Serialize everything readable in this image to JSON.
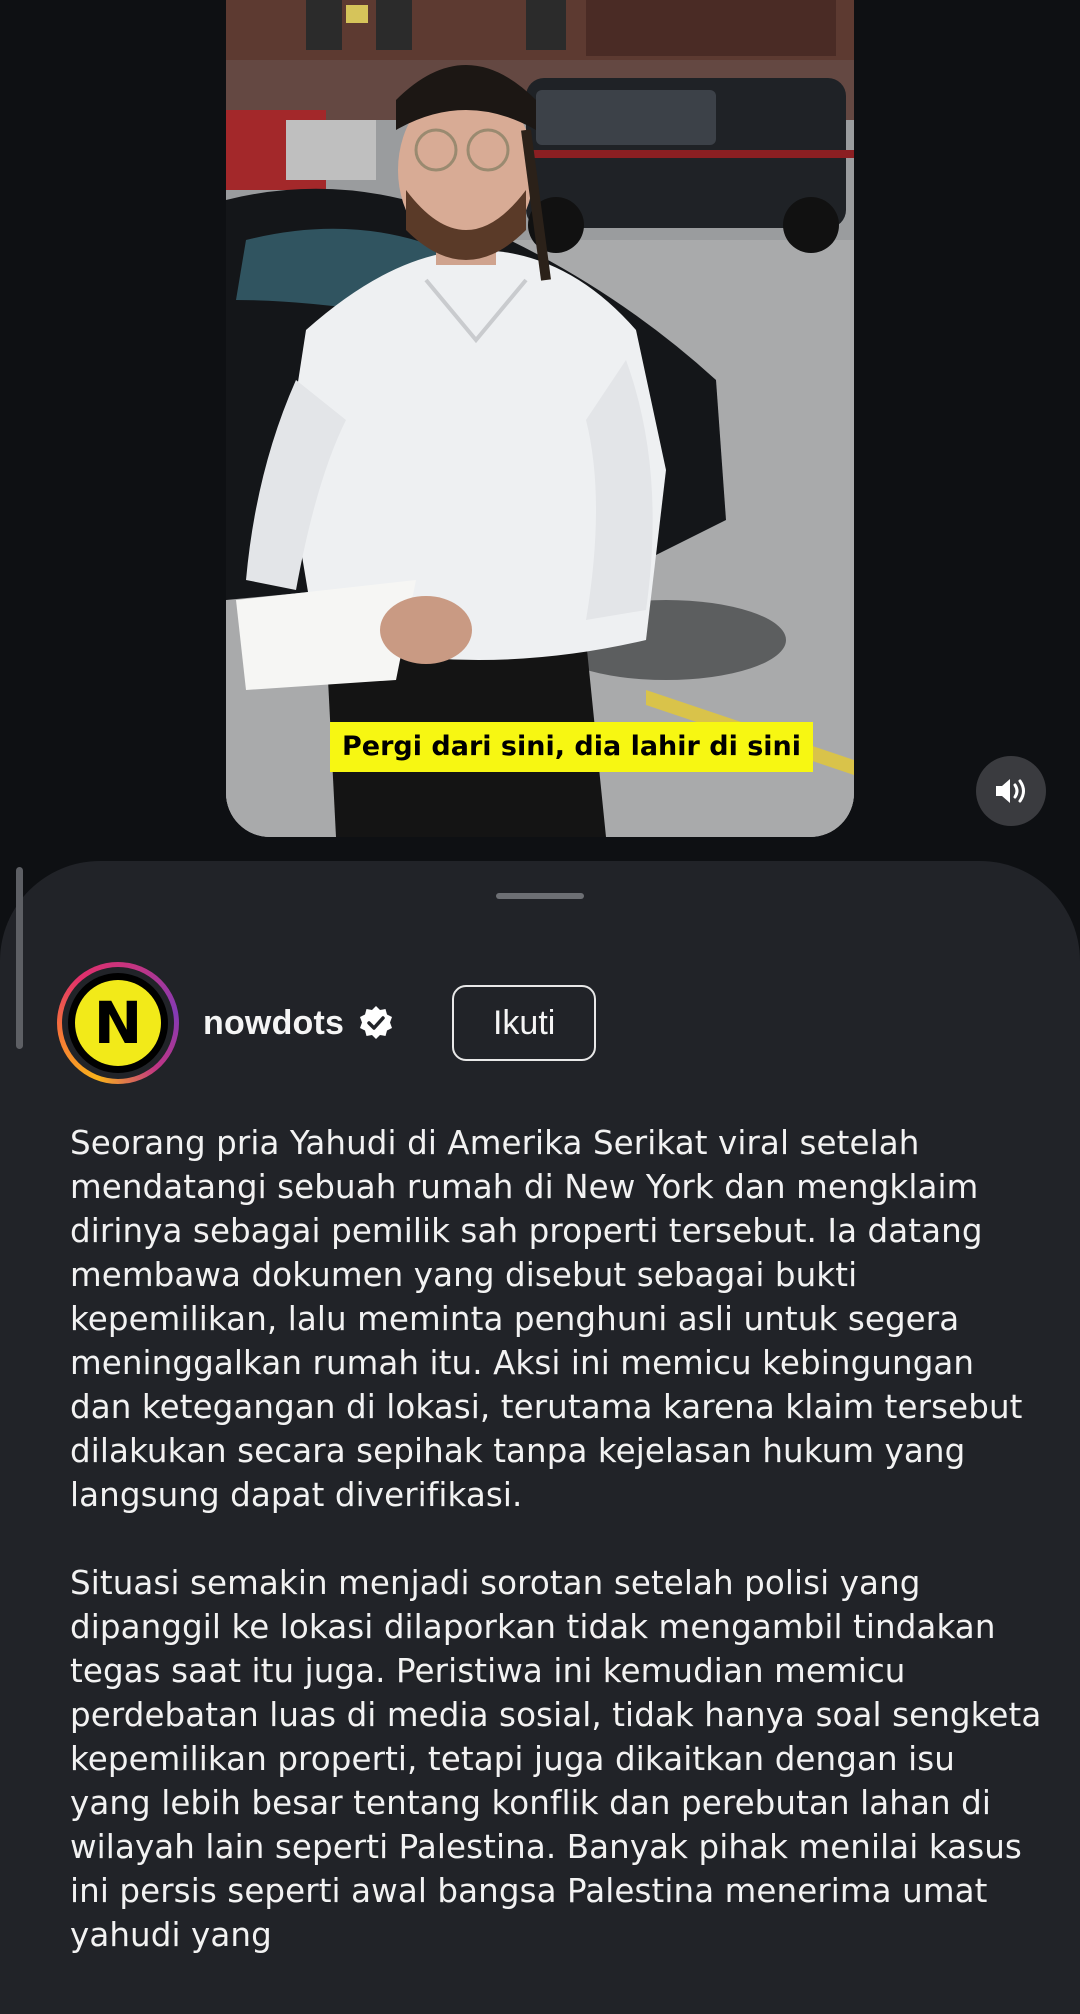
{
  "video": {
    "subtitle": "Pergi dari sini, dia lahir di sini",
    "sound_icon": "volume-icon"
  },
  "post": {
    "avatar_letter": "N",
    "username": "nowdots",
    "verified_icon": "verified-badge-icon",
    "follow_label": "Ikuti",
    "caption": [
      "Seorang pria Yahudi di Amerika Serikat viral setelah mendatangi sebuah rumah di New York dan mengklaim dirinya sebagai pemilik sah properti tersebut. Ia datang membawa dokumen yang disebut sebagai bukti kepemilikan, lalu meminta penghuni asli untuk segera meninggalkan rumah itu. Aksi ini memicu kebingungan dan ketegangan di lokasi, terutama karena klaim tersebut dilakukan secara sepihak tanpa kejelasan hukum yang langsung dapat diverifikasi.",
      "Situasi semakin menjadi sorotan setelah polisi yang dipanggil ke lokasi dilaporkan tidak mengambil tindakan tegas saat itu juga. Peristiwa ini kemudian memicu perdebatan luas di media sosial, tidak hanya soal sengketa kepemilikan properti, tetapi juga dikaitkan dengan isu yang lebih besar tentang konflik dan perebutan lahan di wilayah lain seperti Palestina. Banyak pihak menilai kasus ini persis seperti awal bangsa Palestina menerima umat yahudi yang"
    ]
  },
  "colors": {
    "background": "#0e1013",
    "sheet": "#212328",
    "subtitle_bg": "#f7f712",
    "avatar_bg": "#f2ea19",
    "text": "#f2f2f2"
  }
}
